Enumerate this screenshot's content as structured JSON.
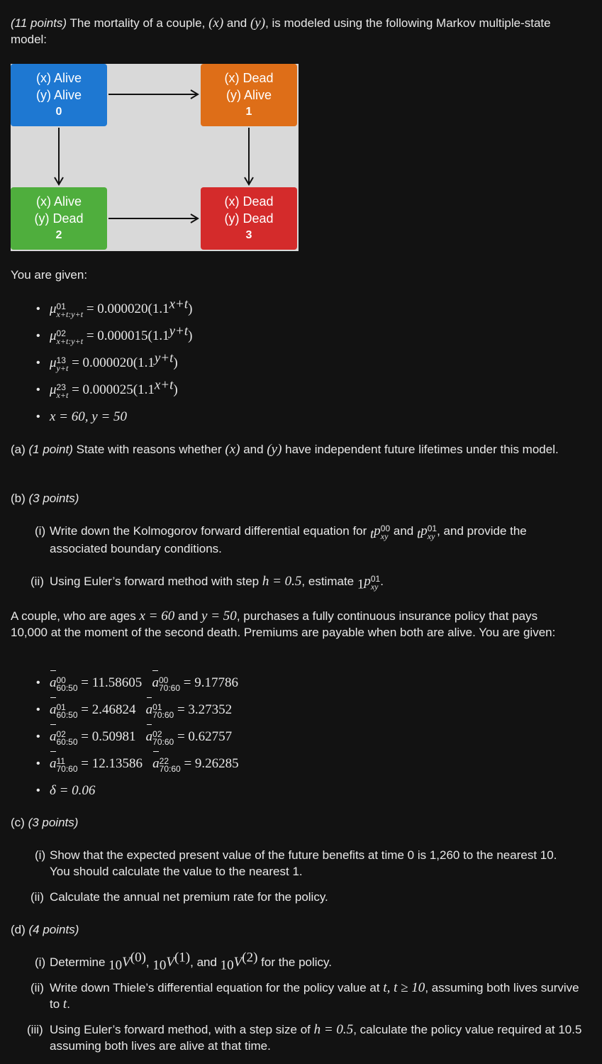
{
  "intro": {
    "points": "(11 points)",
    "text": " The mortality of a couple, ",
    "x": "(x)",
    "and": " and ",
    "y": "(y)",
    "rest": ", is modeled using the following Markov multiple-state model:"
  },
  "diagram": {
    "states": [
      {
        "line1": "(x) Alive",
        "line2": "(y) Alive",
        "num": "0",
        "color": "#1e78d2"
      },
      {
        "line1": "(x) Dead",
        "line2": "(y) Alive",
        "num": "1",
        "color": "#de6e18"
      },
      {
        "line1": "(x) Alive",
        "line2": "(y) Dead",
        "num": "2",
        "color": "#4fae3d"
      },
      {
        "line1": "(x) Dead",
        "line2": "(y) Dead",
        "num": "3",
        "color": "#d42b2b"
      }
    ]
  },
  "given1": {
    "label": "You are given:",
    "items": [
      {
        "mu": "μ",
        "sup": "01",
        "sub": "x+t:y+t",
        "rhs": " = 0.000020(1.1",
        "exp": "x+t",
        "close": ")"
      },
      {
        "mu": "μ",
        "sup": "02",
        "sub": "x+t:y+t",
        "rhs": " = 0.000015(1.1",
        "exp": "y+t",
        "close": ")"
      },
      {
        "mu": "μ",
        "sup": "13",
        "sub": "y+t",
        "rhs": " = 0.000020(1.1",
        "exp": "y+t",
        "close": ")"
      },
      {
        "mu": "μ",
        "sup": "23",
        "sub": "x+t",
        "rhs": " = 0.000025(1.1",
        "exp": "x+t",
        "close": ")"
      }
    ],
    "ages": "x = 60, y = 50"
  },
  "part_a": {
    "label": "(a)",
    "points": "(1 point)",
    "text1": " State with reasons whether ",
    "x": "(x)",
    "and": " and ",
    "y": "(y)",
    "text2": " have independent future lifetimes under this model."
  },
  "part_b": {
    "label": "(b)",
    "points": "(3 points)",
    "i_num": "(i)",
    "i_text1": "Write down the Kolmogorov forward differential equation for ",
    "i_and": " and ",
    "i_text2": ", and provide the associated boundary conditions.",
    "pre": "t",
    "p": "p",
    "sup00": "00",
    "sup01": "01",
    "subxy": "xy",
    "ii_num": "(ii)",
    "ii_text": "Using Euler’s forward method with step ",
    "ii_h": "h = 0.5",
    "ii_text2": ", estimate ",
    "ii_pre": "1",
    "ii_end": "."
  },
  "couple": {
    "text1": "A couple, who are ages ",
    "x60": "x = 60",
    "and": " and ",
    "y50": "y = 50",
    "text2": ", purchases a fully continuous insurance policy that pays 10,000 at the moment of the second death. Premiums are payable when both are alive. You are given:"
  },
  "given2": {
    "a": "a",
    "items": [
      {
        "sup1": "00",
        "sub1": "60:50",
        "v1": " = 11.58605",
        "sup2": "00",
        "sub2": "70:60",
        "v2": " = 9.17786"
      },
      {
        "sup1": "01",
        "sub1": "60:50",
        "v1": " = 2.46824",
        "sup2": "01",
        "sub2": "70:60",
        "v2": " = 3.27352"
      },
      {
        "sup1": "02",
        "sub1": "60:50",
        "v1": " = 0.50981",
        "sup2": "02",
        "sub2": "70:60",
        "v2": " = 0.62757"
      },
      {
        "sup1": "11",
        "sub1": "70:60",
        "v1": " = 12.13586",
        "sup2": "22",
        "sub2": "70:60",
        "v2": " = 9.26285"
      }
    ],
    "delta": "δ = 0.06"
  },
  "part_c": {
    "label": "(c)",
    "points": "(3 points)",
    "i_num": "(i)",
    "i_text": "Show that the expected present value of the future benefits at time 0 is 1,260 to the nearest 10. You should calculate the value to the nearest 1.",
    "ii_num": "(ii)",
    "ii_text": "Calculate the annual net premium rate for the policy."
  },
  "part_d": {
    "label": "(d)",
    "points": "(4 points)",
    "i_num": "(i)",
    "i_text1": "Determine ",
    "pre": "10",
    "V": "V",
    "s0": "(0)",
    "s1": "(1)",
    "s2": "(2)",
    "comma": ", ",
    "and": ", and ",
    "i_text2": " for the policy.",
    "ii_num": "(ii)",
    "ii_text1": "Write down Thiele’s differential equation for the policy value at ",
    "ii_math": "t, t ≥ 10",
    "ii_text2": ", assuming both lives survive to ",
    "ii_t": "t",
    "ii_end": ".",
    "iii_num": "(iii)",
    "iii_text1": "Using Euler’s forward method, with a step size of ",
    "iii_h": "h = 0.5",
    "iii_text2": ", calculate the policy value required at 10.5 assuming both lives are alive at that time."
  }
}
